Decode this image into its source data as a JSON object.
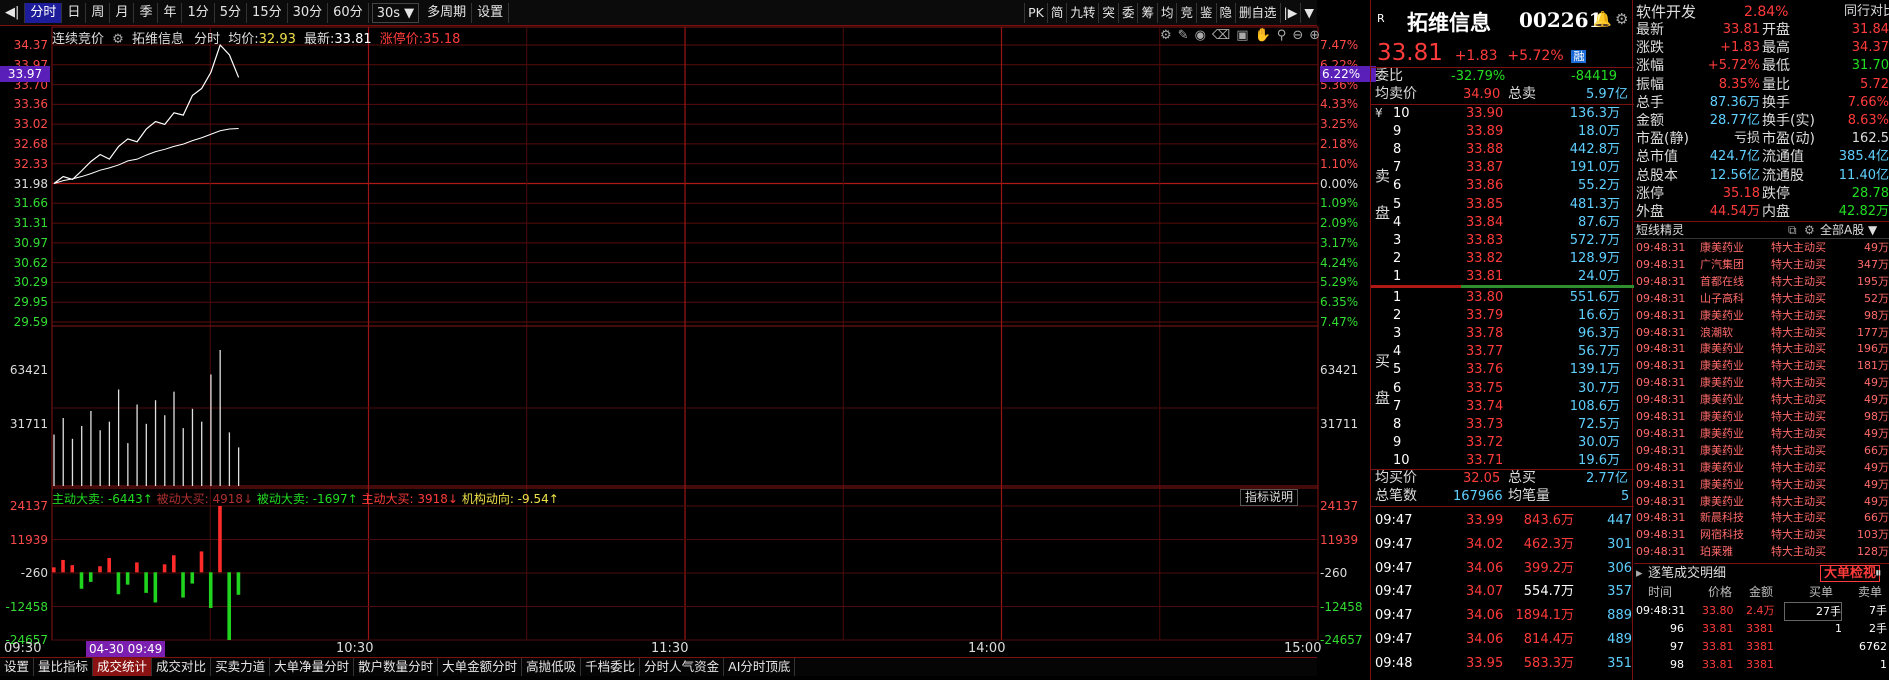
{
  "toolbar": {
    "periods": [
      "分时",
      "日",
      "周",
      "月",
      "季",
      "年",
      "1分",
      "5分",
      "15分",
      "30分",
      "60分"
    ],
    "period_select": "30s",
    "multi_period": "多周期",
    "settings": "设置",
    "right_tools": [
      "PK",
      "简",
      "九转",
      "突",
      "委",
      "筹",
      "均",
      "竞",
      "鉴",
      "隐",
      "删自选"
    ]
  },
  "chart_header": {
    "auction": "连续竞价",
    "stock_name": "拓维信息",
    "mode": "分时",
    "avg_label": "均价:",
    "avg_value": "32.93",
    "latest_label": "最新:",
    "latest_value": "33.81",
    "limit_label": "涨停价:",
    "limit_value": "35.18"
  },
  "price_axis": {
    "left": [
      "34.37",
      "33.97",
      "33.70",
      "33.36",
      "33.02",
      "32.68",
      "32.33",
      "31.98",
      "31.66",
      "31.31",
      "30.97",
      "30.62",
      "30.29",
      "29.95",
      "29.59"
    ],
    "right": [
      "7.47%",
      "6.22%",
      "5.36%",
      "4.33%",
      "3.25%",
      "2.18%",
      "1.10%",
      "0.00%",
      "1.09%",
      "2.09%",
      "3.17%",
      "4.24%",
      "5.29%",
      "6.35%",
      "7.47%"
    ],
    "current_price": "33.97",
    "current_pct": "6.22%"
  },
  "volume_axis": {
    "labels": [
      "63421",
      "31711"
    ]
  },
  "flow_axis": {
    "labels": [
      "24137",
      "11939",
      "-260",
      "-12458",
      "-24657"
    ]
  },
  "flow_bar": {
    "active_sell": "主动大卖: -6443↑",
    "passive_buy": "被动大买: 4918↓",
    "passive_sell": "被动大卖: -1697↑",
    "active_buy": "主动大买: 3918↓",
    "inst": "机构动向: -9.54↑"
  },
  "indicator_button": "指标说明",
  "time_axis": {
    "start": "09:30",
    "date": "04-30 09:49",
    "t1030": "10:30",
    "t1130": "11:30",
    "t1400": "14:00",
    "t1500": "15:00"
  },
  "bottom_tabs": [
    "设置",
    "量比指标",
    "成交统计",
    "成交对比",
    "买卖力道",
    "大单净量分时",
    "散户数量分时",
    "大单金额分时",
    "高抛低吸",
    "千档委比",
    "分时人气资金",
    "AI分时顶底"
  ],
  "order_book": {
    "badge": "R",
    "name": "拓维信息",
    "code": "002261",
    "price": "33.81",
    "change": "+1.83",
    "change_pct": "+5.72%",
    "tag": "融",
    "weibi_label": "委比",
    "weibi_pct": "-32.79%",
    "weibi_val": "-84419",
    "avg_sell_label": "均卖价",
    "avg_sell": "34.90",
    "total_sell_label": "总卖",
    "total_sell": "5.97亿",
    "currency": "¥",
    "sell_label": "卖",
    "pan_label": "盘",
    "buy_label": "买",
    "asks": [
      {
        "lv": "10",
        "p": "33.90",
        "v": "136.3万"
      },
      {
        "lv": "9",
        "p": "33.89",
        "v": "18.0万"
      },
      {
        "lv": "8",
        "p": "33.88",
        "v": "442.8万"
      },
      {
        "lv": "7",
        "p": "33.87",
        "v": "191.0万"
      },
      {
        "lv": "6",
        "p": "33.86",
        "v": "55.2万"
      },
      {
        "lv": "5",
        "p": "33.85",
        "v": "481.3万"
      },
      {
        "lv": "4",
        "p": "33.84",
        "v": "87.6万"
      },
      {
        "lv": "3",
        "p": "33.83",
        "v": "572.7万"
      },
      {
        "lv": "2",
        "p": "33.82",
        "v": "128.9万"
      },
      {
        "lv": "1",
        "p": "33.81",
        "v": "24.0万"
      }
    ],
    "bids": [
      {
        "lv": "1",
        "p": "33.80",
        "v": "551.6万"
      },
      {
        "lv": "2",
        "p": "33.79",
        "v": "16.6万"
      },
      {
        "lv": "3",
        "p": "33.78",
        "v": "96.3万"
      },
      {
        "lv": "4",
        "p": "33.77",
        "v": "56.7万"
      },
      {
        "lv": "5",
        "p": "33.76",
        "v": "139.1万"
      },
      {
        "lv": "6",
        "p": "33.75",
        "v": "30.7万"
      },
      {
        "lv": "7",
        "p": "33.74",
        "v": "108.6万"
      },
      {
        "lv": "8",
        "p": "33.73",
        "v": "72.5万"
      },
      {
        "lv": "9",
        "p": "33.72",
        "v": "30.0万"
      },
      {
        "lv": "10",
        "p": "33.71",
        "v": "19.6万"
      }
    ],
    "avg_buy_label": "均买价",
    "avg_buy": "32.05",
    "total_buy_label": "总买",
    "total_buy": "2.77亿",
    "total_count_label": "总笔数",
    "total_count": "167966",
    "avg_vol_label": "均笔量",
    "avg_vol": "5",
    "ticks": [
      {
        "t": "09:47",
        "p": "33.99",
        "a": "843.6万",
        "n": "447"
      },
      {
        "t": "09:47",
        "p": "34.02",
        "a": "462.3万",
        "n": "301"
      },
      {
        "t": "09:47",
        "p": "34.06",
        "a": "399.2万",
        "n": "306"
      },
      {
        "t": "09:47",
        "p": "34.07",
        "a": "554.7万",
        "n": "357"
      },
      {
        "t": "09:47",
        "p": "34.06",
        "a": "1894.1万",
        "n": "889"
      },
      {
        "t": "09:47",
        "p": "34.06",
        "a": "814.4万",
        "n": "489"
      },
      {
        "t": "09:48",
        "p": "33.95",
        "a": "583.3万",
        "n": "351"
      }
    ]
  },
  "right_panel": {
    "sector": "软件开发",
    "sector_pct": "2.84%",
    "compare": "同行对比",
    "quote": [
      {
        "k1": "最新",
        "v1": "33.81",
        "k2": "开盘",
        "v2": "31.84"
      },
      {
        "k1": "涨跌",
        "v1": "+1.83",
        "k2": "最高",
        "v2": "34.37"
      },
      {
        "k1": "涨幅",
        "v1": "+5.72%",
        "k2": "最低",
        "v2": "31.70"
      },
      {
        "k1": "振幅",
        "v1": "8.35%",
        "k2": "量比",
        "v2": "5.72"
      },
      {
        "k1": "总手",
        "v1": "87.36万",
        "k2": "换手",
        "v2": "7.66%"
      },
      {
        "k1": "金额",
        "v1": "28.77亿",
        "k2": "换手(实)",
        "v2": "8.63%"
      },
      {
        "k1": "市盈(静)",
        "v1": "亏损",
        "k2": "市盈(动)",
        "v2": "162.5"
      },
      {
        "k1": "总市值",
        "v1": "424.7亿",
        "k2": "流通值",
        "v2": "385.4亿"
      },
      {
        "k1": "总股本",
        "v1": "12.56亿",
        "k2": "流通股",
        "v2": "11.40亿"
      },
      {
        "k1": "涨停",
        "v1": "35.18",
        "k2": "跌停",
        "v2": "28.78"
      },
      {
        "k1": "外盘",
        "v1": "44.54万",
        "k2": "内盘",
        "v2": "42.82万"
      }
    ],
    "short_title": "短线精灵",
    "short_filter": "全部A股",
    "short_rows": [
      {
        "t": "09:48:31",
        "n": "康美药业",
        "e": "特大主动买",
        "v": "49万"
      },
      {
        "t": "09:48:31",
        "n": "广汽集团",
        "e": "特大主动买",
        "v": "347万"
      },
      {
        "t": "09:48:31",
        "n": "首都在线",
        "e": "特大主动买",
        "v": "195万"
      },
      {
        "t": "09:48:31",
        "n": "山子高科",
        "e": "特大主动买",
        "v": "52万"
      },
      {
        "t": "09:48:31",
        "n": "康美药业",
        "e": "特大主动买",
        "v": "98万"
      },
      {
        "t": "09:48:31",
        "n": "浪潮软",
        "e": "特大主动买",
        "v": "177万"
      },
      {
        "t": "09:48:31",
        "n": "康美药业",
        "e": "特大主动买",
        "v": "196万"
      },
      {
        "t": "09:48:31",
        "n": "康美药业",
        "e": "特大主动买",
        "v": "181万"
      },
      {
        "t": "09:48:31",
        "n": "康美药业",
        "e": "特大主动买",
        "v": "49万"
      },
      {
        "t": "09:48:31",
        "n": "康美药业",
        "e": "特大主动买",
        "v": "49万"
      },
      {
        "t": "09:48:31",
        "n": "康美药业",
        "e": "特大主动买",
        "v": "98万"
      },
      {
        "t": "09:48:31",
        "n": "康美药业",
        "e": "特大主动买",
        "v": "49万"
      },
      {
        "t": "09:48:31",
        "n": "康美药业",
        "e": "特大主动买",
        "v": "66万"
      },
      {
        "t": "09:48:31",
        "n": "康美药业",
        "e": "特大主动买",
        "v": "49万"
      },
      {
        "t": "09:48:31",
        "n": "康美药业",
        "e": "特大主动买",
        "v": "49万"
      },
      {
        "t": "09:48:31",
        "n": "康美药业",
        "e": "特大主动买",
        "v": "49万"
      },
      {
        "t": "09:48:31",
        "n": "新晨科技",
        "e": "特大主动买",
        "v": "66万"
      },
      {
        "t": "09:48:31",
        "n": "网宿科技",
        "e": "特大主动买",
        "v": "103万"
      },
      {
        "t": "09:48:31",
        "n": "珀莱雅",
        "e": "特大主动买",
        "v": "128万"
      }
    ],
    "detail_title": "逐笔成交明细",
    "big_order_btn": "大单检视",
    "detail_headers": [
      "时间",
      "价格",
      "金额",
      "买单",
      "卖单"
    ],
    "detail_rows": [
      {
        "t": "09:48:31",
        "p": "33.80",
        "a": "2.4万",
        "b": "27手",
        "s": "7手"
      },
      {
        "t": "96",
        "p": "33.81",
        "a": "3381",
        "b": "1",
        "s": "2手"
      },
      {
        "t": "97",
        "p": "33.81",
        "a": "3381",
        "b": "",
        "s": "6762"
      },
      {
        "t": "98",
        "p": "33.81",
        "a": "3381",
        "b": "",
        "s": "1"
      }
    ]
  },
  "chart_data": {
    "type": "line",
    "price_series": [
      31.98,
      32.1,
      32.05,
      32.2,
      32.36,
      32.48,
      32.4,
      32.62,
      32.75,
      32.7,
      32.92,
      33.05,
      33.0,
      33.2,
      33.16,
      33.5,
      33.62,
      33.9,
      34.37,
      34.2,
      33.81
    ],
    "avg_series": [
      31.98,
      32.03,
      32.06,
      32.1,
      32.15,
      32.21,
      32.25,
      32.3,
      32.37,
      32.4,
      32.47,
      32.53,
      32.57,
      32.62,
      32.66,
      32.72,
      32.77,
      32.83,
      32.89,
      32.92,
      32.93
    ],
    "volume": [
      24000,
      31711,
      22000,
      28000,
      35000,
      26000,
      30000,
      45000,
      20000,
      38000,
      29000,
      40000,
      33000,
      44000,
      27000,
      36000,
      30000,
      52000,
      63421,
      25000,
      18000
    ],
    "flow": [
      1800,
      4500,
      2600,
      -6000,
      -3500,
      2200,
      5200,
      -8000,
      -4500,
      3600,
      -7500,
      -11000,
      2900,
      6200,
      -9200,
      -4100,
      7600,
      -13000,
      24137,
      -24657,
      -8200
    ],
    "ylim": [
      29.59,
      34.37
    ],
    "volume_max": 63421,
    "flow_range": [
      -24657,
      24137
    ]
  }
}
